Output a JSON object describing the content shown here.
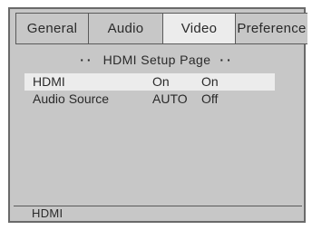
{
  "tabs": [
    {
      "label": "General",
      "active": false
    },
    {
      "label": "Audio",
      "active": false
    },
    {
      "label": "Video",
      "active": true
    },
    {
      "label": "Preference",
      "active": false
    }
  ],
  "page": {
    "title": "HDMI Setup Page",
    "dots": "··"
  },
  "settings": [
    {
      "label": "HDMI",
      "value": "On",
      "selected": true
    },
    {
      "label": "Audio Source",
      "value": "AUTO",
      "selected": false
    }
  ],
  "dropdown": {
    "options": [
      {
        "label": "On",
        "highlighted": true
      },
      {
        "label": "Off",
        "highlighted": false
      }
    ]
  },
  "status": {
    "text": "HDMI"
  },
  "colors": {
    "background": "#c7c7c7",
    "highlight": "#ececec",
    "border": "#5a5a5a",
    "text": "#2a2a2a"
  }
}
